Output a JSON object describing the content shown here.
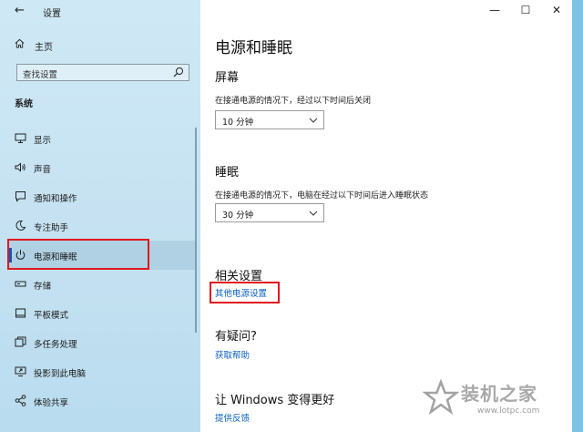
{
  "window": {
    "title": "设置",
    "minimize": "—",
    "maximize": "☐",
    "close": "✕"
  },
  "sidebar": {
    "home": "主页",
    "search_placeholder": "查找设置",
    "section": "系统",
    "items": [
      {
        "label": "显示",
        "icon": "monitor-icon"
      },
      {
        "label": "声音",
        "icon": "speaker-icon"
      },
      {
        "label": "通知和操作",
        "icon": "notification-icon"
      },
      {
        "label": "专注助手",
        "icon": "moon-icon"
      },
      {
        "label": "电源和睡眠",
        "icon": "power-icon",
        "active": true
      },
      {
        "label": "存储",
        "icon": "storage-icon"
      },
      {
        "label": "平板模式",
        "icon": "tablet-icon"
      },
      {
        "label": "多任务处理",
        "icon": "multitask-icon"
      },
      {
        "label": "投影到此电脑",
        "icon": "project-icon"
      },
      {
        "label": "体验共享",
        "icon": "share-icon"
      }
    ]
  },
  "main": {
    "title": "电源和睡眠",
    "screen": {
      "heading": "屏幕",
      "desc": "在接通电源的情况下，经过以下时间后关闭",
      "value": "10 分钟"
    },
    "sleep": {
      "heading": "睡眠",
      "desc": "在接通电源的情况下，电脑在经过以下时间后进入睡眠状态",
      "value": "30 分钟"
    },
    "related": {
      "heading": "相关设置",
      "link": "其他电源设置"
    },
    "faq": {
      "heading": "有疑问?",
      "link": "获取帮助"
    },
    "improve": {
      "heading": "让 Windows 变得更好",
      "link": "提供反馈"
    }
  },
  "watermark": {
    "text": "装机之家",
    "url": "www.lotpc.com"
  },
  "colors": {
    "accent": "#0a61c0",
    "highlight": "#e0181f",
    "active_bar": "#0a5bb5"
  }
}
